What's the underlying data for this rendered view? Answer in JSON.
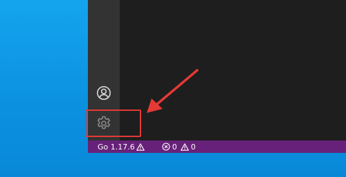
{
  "window": {
    "activity_bar": {
      "items": [
        {
          "name": "account",
          "icon": "account-icon"
        },
        {
          "name": "manage",
          "icon": "gear-icon"
        }
      ]
    }
  },
  "status_bar": {
    "go_version_label": "Go 1.17.6",
    "go_version_icon": "warning-icon",
    "errors_count": "0",
    "warnings_count": "0",
    "background_color": "#68217a"
  },
  "annotation": {
    "highlight_color": "#e53935",
    "arrow_color": "#e53935",
    "target": "gear-icon"
  }
}
